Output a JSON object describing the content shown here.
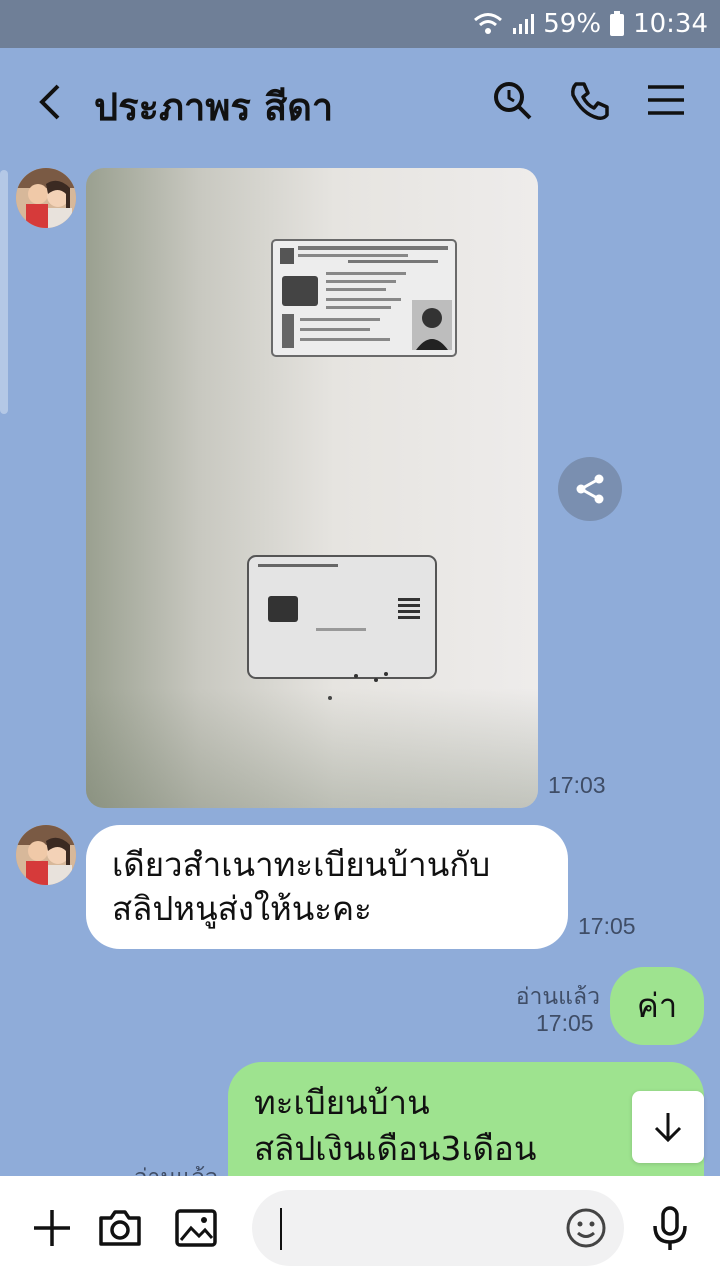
{
  "status_bar": {
    "battery": "59%",
    "time": "10:34"
  },
  "header": {
    "title": "ประภาพร สีดา"
  },
  "messages": {
    "image_time": "17:03",
    "incoming_text": [
      "เดียวสำเนาทะเบียนบ้านกับ",
      "สลิปหนูส่งให้นะคะ"
    ],
    "incoming_time": "17:05",
    "read_label": "อ่านแล้ว",
    "outgoing_short": "ค่า",
    "outgoing_short_time": "17:05",
    "outgoing_long": [
      "ทะเบียนบ้าน",
      "สลิปเงินเดือน3เดือน"
    ],
    "outgoing_long_read": "อ่านแล้ว"
  },
  "colors": {
    "background": "#8facd9",
    "bubble_out": "#9ee38f",
    "bubble_in": "#ffffff"
  }
}
